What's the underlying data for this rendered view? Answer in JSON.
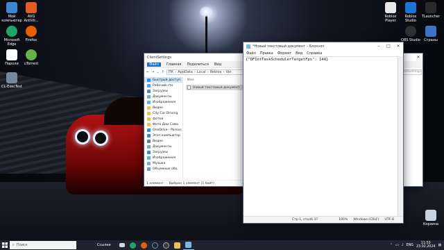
{
  "desktop_icons": [
    {
      "label": "Мой компьютер",
      "color": "#3a86d1"
    },
    {
      "label": "AVG AntiVir...",
      "color": "#e35d22"
    },
    {
      "label": "Microsoft Edge",
      "color": "#1fa46a"
    },
    {
      "label": "Firefox",
      "color": "#e66000"
    },
    {
      "label": "Пароли",
      "color": "#ffffff"
    },
    {
      "label": "uTorrent",
      "color": "#67b346"
    },
    {
      "label": "CL-ExecTest",
      "color": "#7a8797"
    },
    {
      "label": "Roblox Player",
      "color": "#e8e8e8"
    },
    {
      "label": "Roblox Studio",
      "color": "#1b72d8"
    },
    {
      "label": "TLauncher",
      "color": "#2a2a2a"
    },
    {
      "label": "OBS Studio",
      "color": "#302e31"
    },
    {
      "label": "Страны",
      "color": "#3b73c5"
    },
    {
      "label": "Корзина",
      "color": "#c9d3df"
    }
  ],
  "explorer": {
    "title": "ClientSettings",
    "ribbon": [
      "Файл",
      "Главная",
      "Поделиться",
      "Вид"
    ],
    "path": [
      "ПК",
      "AppData",
      "Local",
      "Roblox",
      "Ver"
    ],
    "search_placeholder": "Поиск: ClientSettings",
    "nav_items": [
      {
        "label": "Быстрый доступ",
        "color": "#2f8ae0",
        "selected": true
      },
      {
        "label": "Рабочий сто",
        "color": "#4aa3ef"
      },
      {
        "label": "Загрузки",
        "color": "#3c8ad8"
      },
      {
        "label": "Документы",
        "color": "#7aa6d0"
      },
      {
        "label": "Изображения",
        "color": "#5db0e6"
      },
      {
        "label": "Видео",
        "color": "#e8c257"
      },
      {
        "label": "City Car Driving",
        "color": "#e8c257"
      },
      {
        "label": "фотки",
        "color": "#e8c257"
      },
      {
        "label": "Фото Дни Само",
        "color": "#e8c257"
      },
      {
        "label": "OneDrive - Person",
        "color": "#2f8ae0"
      },
      {
        "label": "Этот компьютер",
        "color": "#3a86d1"
      },
      {
        "label": "Видео",
        "color": "#6a7ca0"
      },
      {
        "label": "Документы",
        "color": "#7aa6d0"
      },
      {
        "label": "Загрузки",
        "color": "#3c8ad8"
      },
      {
        "label": "Изображения",
        "color": "#5db0e6"
      },
      {
        "label": "Музыка",
        "color": "#6fb2e6"
      },
      {
        "label": "Объемные объ",
        "color": "#5aa0d0"
      }
    ],
    "column_header": "Имя",
    "file": "Новый текстовый документ",
    "status_count": "1 элемент",
    "status_selected": "Выбран 1 элемент (1 байт)"
  },
  "notepad": {
    "title": "*Новый текстовый документ – Блокнот",
    "menu": [
      "Файл",
      "Правка",
      "Формат",
      "Вид",
      "Справка"
    ],
    "content": "{\"DFIntTaskSchedulerTargetFps\": 144}",
    "status": {
      "position": "Стр 1, столб 37",
      "zoom": "100%",
      "eol": "Windows (CRLF)",
      "encoding": "UTF-8"
    }
  },
  "taskbar": {
    "search_placeholder": "Поиск",
    "links_label": "Ссылки",
    "apps": [
      {
        "name": "windows-icon",
        "color": "#ffffff"
      },
      {
        "name": "task-view-icon",
        "color": "#cfd6e4"
      },
      {
        "name": "edge-icon",
        "color": "#1fa46a"
      },
      {
        "name": "firefox-icon",
        "color": "#e66000"
      },
      {
        "name": "steam-icon",
        "color": "#1b2838"
      },
      {
        "name": "obs-icon",
        "color": "#3a3a3a"
      },
      {
        "name": "explorer-icon",
        "color": "#e8c257"
      },
      {
        "name": "notepad-icon",
        "color": "#7bb8e0"
      }
    ],
    "tray": {
      "lang": "ENG",
      "time": "11:50",
      "date": "23.02.2024"
    }
  }
}
